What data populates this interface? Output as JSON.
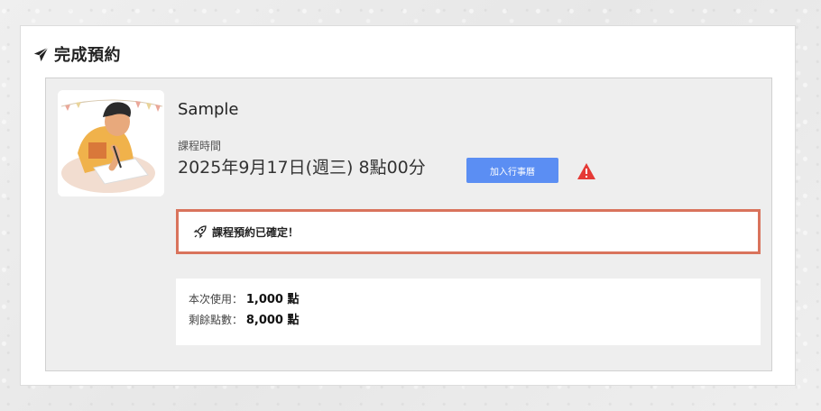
{
  "header": {
    "title": "完成預約",
    "icon": "paper-plane-icon"
  },
  "course": {
    "name": "Sample",
    "time_label": "課程時間",
    "time_value": "2025年9月17日(週三) 8點00分",
    "calendar_button": "加入行事曆",
    "warning_icon": "warning-icon"
  },
  "confirmation": {
    "icon": "rocket-icon",
    "text": "課程預約已確定！"
  },
  "points": {
    "used_label": "本次使用：",
    "used_value": "1,000 點",
    "remaining_label": "剩餘點數：",
    "remaining_value": "8,000 點"
  },
  "colors": {
    "button": "#5b8ef3",
    "confirm_border": "#d9735c",
    "warning": "#e53935"
  }
}
